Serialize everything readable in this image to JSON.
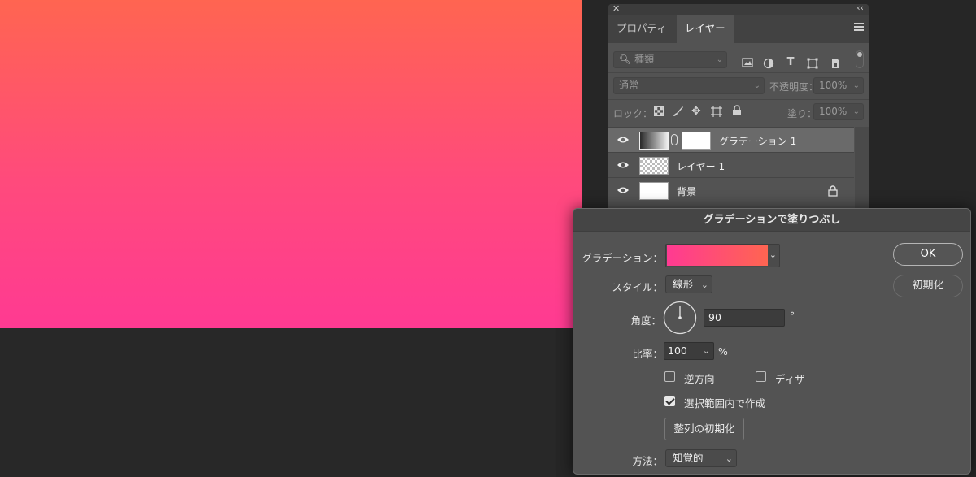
{
  "colors": {
    "gradient_start": "#ff3a92",
    "gradient_end": "#ff6551"
  },
  "layers_panel": {
    "tabs": [
      {
        "label": "プロパティ"
      },
      {
        "label": "レイヤー"
      }
    ],
    "filter": {
      "placeholder": "種類"
    },
    "blend_mode": "通常",
    "opacity_label": "不透明度：",
    "opacity_value": "100%",
    "lock_label": "ロック：",
    "fill_label": "塗り：",
    "fill_value": "100%",
    "layers": [
      {
        "name": "グラデーション 1",
        "selected": true
      },
      {
        "name": "レイヤー 1",
        "selected": false
      },
      {
        "name": "背景",
        "selected": false,
        "locked": true
      }
    ]
  },
  "dialog": {
    "title": "グラデーションで塗りつぶし",
    "gradient_label": "グラデーション：",
    "style_label": "スタイル：",
    "style_value": "線形",
    "angle_label": "角度：",
    "angle_value": "90",
    "angle_unit": "°",
    "scale_label": "比率：",
    "scale_value": "100",
    "scale_unit": "%",
    "reverse_label": "逆方向",
    "reverse_checked": false,
    "dither_label": "ディザ",
    "dither_checked": false,
    "align_label": "選択範囲内で作成",
    "align_checked": true,
    "reset_alignment_label": "整列の初期化",
    "method_label": "方法：",
    "method_value": "知覚的",
    "ok_label": "OK",
    "reset_label": "初期化"
  }
}
